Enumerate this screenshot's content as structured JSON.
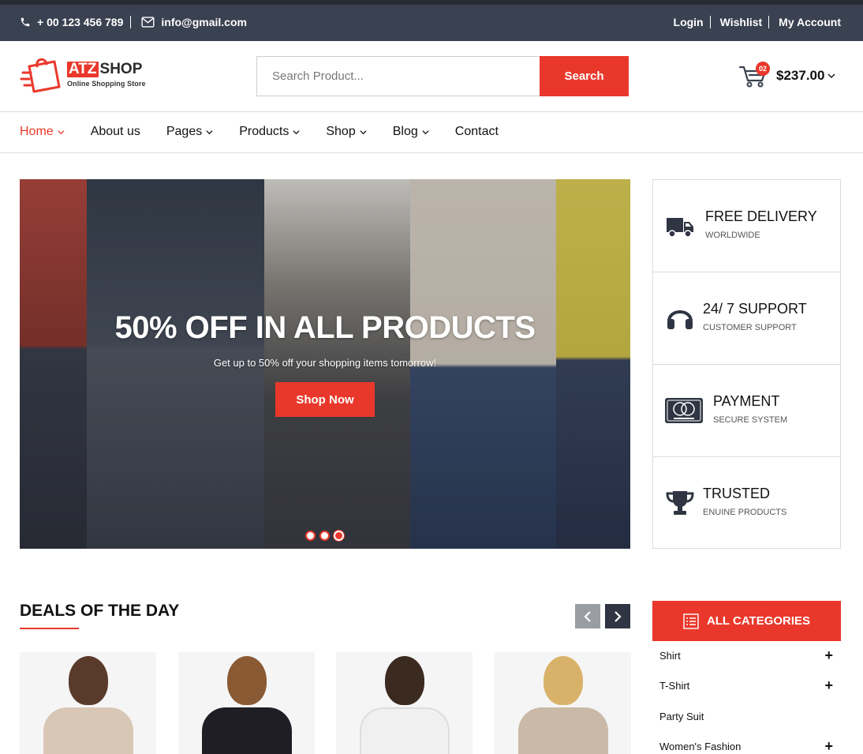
{
  "topbar": {
    "phone": "+ 00 123 456 789",
    "email": "info@gmail.com",
    "links": [
      "Login",
      "Wishlist",
      "My Account"
    ]
  },
  "brand": {
    "name_highlight": "ATZ",
    "name_rest": "SHOP",
    "tagline": "Online Shopping Store",
    "accent_color": "#e9382b",
    "dark_color": "#3a4150"
  },
  "search": {
    "placeholder": "Search Product...",
    "button_label": "Search"
  },
  "cart": {
    "count": "02",
    "total": "$237.00"
  },
  "nav": {
    "items": [
      "Home",
      "About us",
      "Pages",
      "Products",
      "Shop",
      "Blog",
      "Contact"
    ],
    "active": "Home"
  },
  "banner": {
    "title": "50% OFF IN ALL PRODUCTS",
    "subtitle": "Get up to 50% off your shopping items tomorrow!",
    "button_label": "Shop Now",
    "slides": 3,
    "active_slide": 3
  },
  "features": [
    {
      "title": "FREE DELIVERY",
      "subtitle": "WORLDWIDE",
      "icon": "truck-icon"
    },
    {
      "title": "24/ 7 SUPPORT",
      "subtitle": "CUSTOMER SUPPORT",
      "icon": "headset-icon"
    },
    {
      "title": "PAYMENT",
      "subtitle": "SECURE SYSTEM",
      "icon": "credit-card-icon"
    },
    {
      "title": "TRUSTED",
      "subtitle": "ENUINE PRODUCTS",
      "icon": "trophy-icon"
    }
  ],
  "deals": {
    "title": "DEALS OF THE DAY"
  },
  "categories": {
    "header": "ALL CATEGORIES",
    "items": [
      {
        "label": "Shirt",
        "expandable": true
      },
      {
        "label": "T-Shirt",
        "expandable": true
      },
      {
        "label": "Party Suit",
        "expandable": false
      },
      {
        "label": "Women's Fashion",
        "expandable": true
      }
    ]
  }
}
